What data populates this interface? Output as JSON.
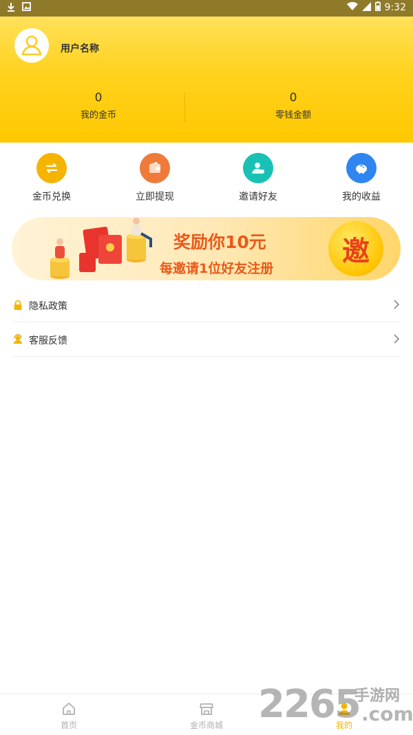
{
  "status_bar": {
    "time": "9:32",
    "left_icons": [
      "download-icon",
      "image-icon"
    ],
    "right_icons": [
      "wifi-icon",
      "signal-icon",
      "battery-icon"
    ]
  },
  "header": {
    "username": "用户名称",
    "stats": [
      {
        "value": "0",
        "label": "我的金币"
      },
      {
        "value": "0",
        "label": "零钱金额"
      }
    ]
  },
  "actions": [
    {
      "label": "金币兑换",
      "icon": "exchange-icon",
      "color": "#f5b400"
    },
    {
      "label": "立即提现",
      "icon": "wallet-icon",
      "color": "#f07a3a"
    },
    {
      "label": "邀请好友",
      "icon": "invite-user-icon",
      "color": "#19c1b5"
    },
    {
      "label": "我的收益",
      "icon": "piggy-bank-icon",
      "color": "#2f86f0"
    }
  ],
  "banner": {
    "title": "奖励你10元",
    "subtitle": "每邀请1位好友注册",
    "badge": "邀"
  },
  "list": [
    {
      "label": "隐私政策",
      "icon": "lock-icon"
    },
    {
      "label": "客服反馈",
      "icon": "customer-service-icon"
    }
  ],
  "bottom_nav": [
    {
      "label": "首页",
      "icon": "home-icon",
      "active": false
    },
    {
      "label": "金币商城",
      "icon": "shop-icon",
      "active": false
    },
    {
      "label": "我的",
      "icon": "profile-icon",
      "active": true
    }
  ],
  "watermark": {
    "digits": "2265",
    "site": "手游网",
    "suffix": ".com"
  },
  "colors": {
    "header_yellow": "#ffd21e",
    "accent_orange": "#e85a1b",
    "active_nav": "#f5b400"
  }
}
